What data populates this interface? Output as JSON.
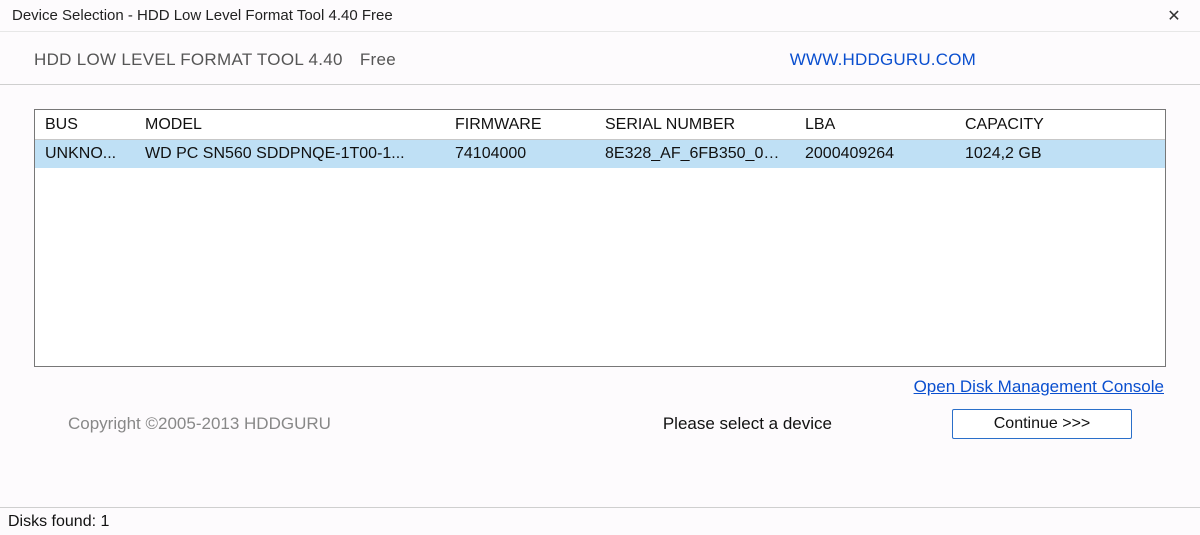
{
  "window": {
    "title": "Device Selection - HDD Low Level Format Tool 4.40    Free"
  },
  "header": {
    "app_name": "HDD LOW LEVEL FORMAT TOOL 4.40",
    "free_label": "Free",
    "website": "WWW.HDDGURU.COM"
  },
  "table": {
    "columns": {
      "bus": "BUS",
      "model": "MODEL",
      "firmware": "FIRMWARE",
      "serial": "SERIAL NUMBER",
      "lba": "LBA",
      "capacity": "CAPACITY"
    },
    "rows": [
      {
        "bus": "UNKNO...",
        "model": "WD PC SN560 SDDPNQE-1T00-1...",
        "firmware": "74104000",
        "serial": "8E328_AF_6FB350_00...",
        "lba": "2000409264",
        "capacity": "1024,2 GB"
      }
    ]
  },
  "links": {
    "disk_mgmt": "Open Disk Management Console"
  },
  "footer": {
    "copyright": "Copyright ©2005-2013 HDDGURU",
    "prompt": "Please select a device",
    "continue_label": "Continue >>>"
  },
  "status": {
    "disks_found": "Disks found: 1"
  }
}
